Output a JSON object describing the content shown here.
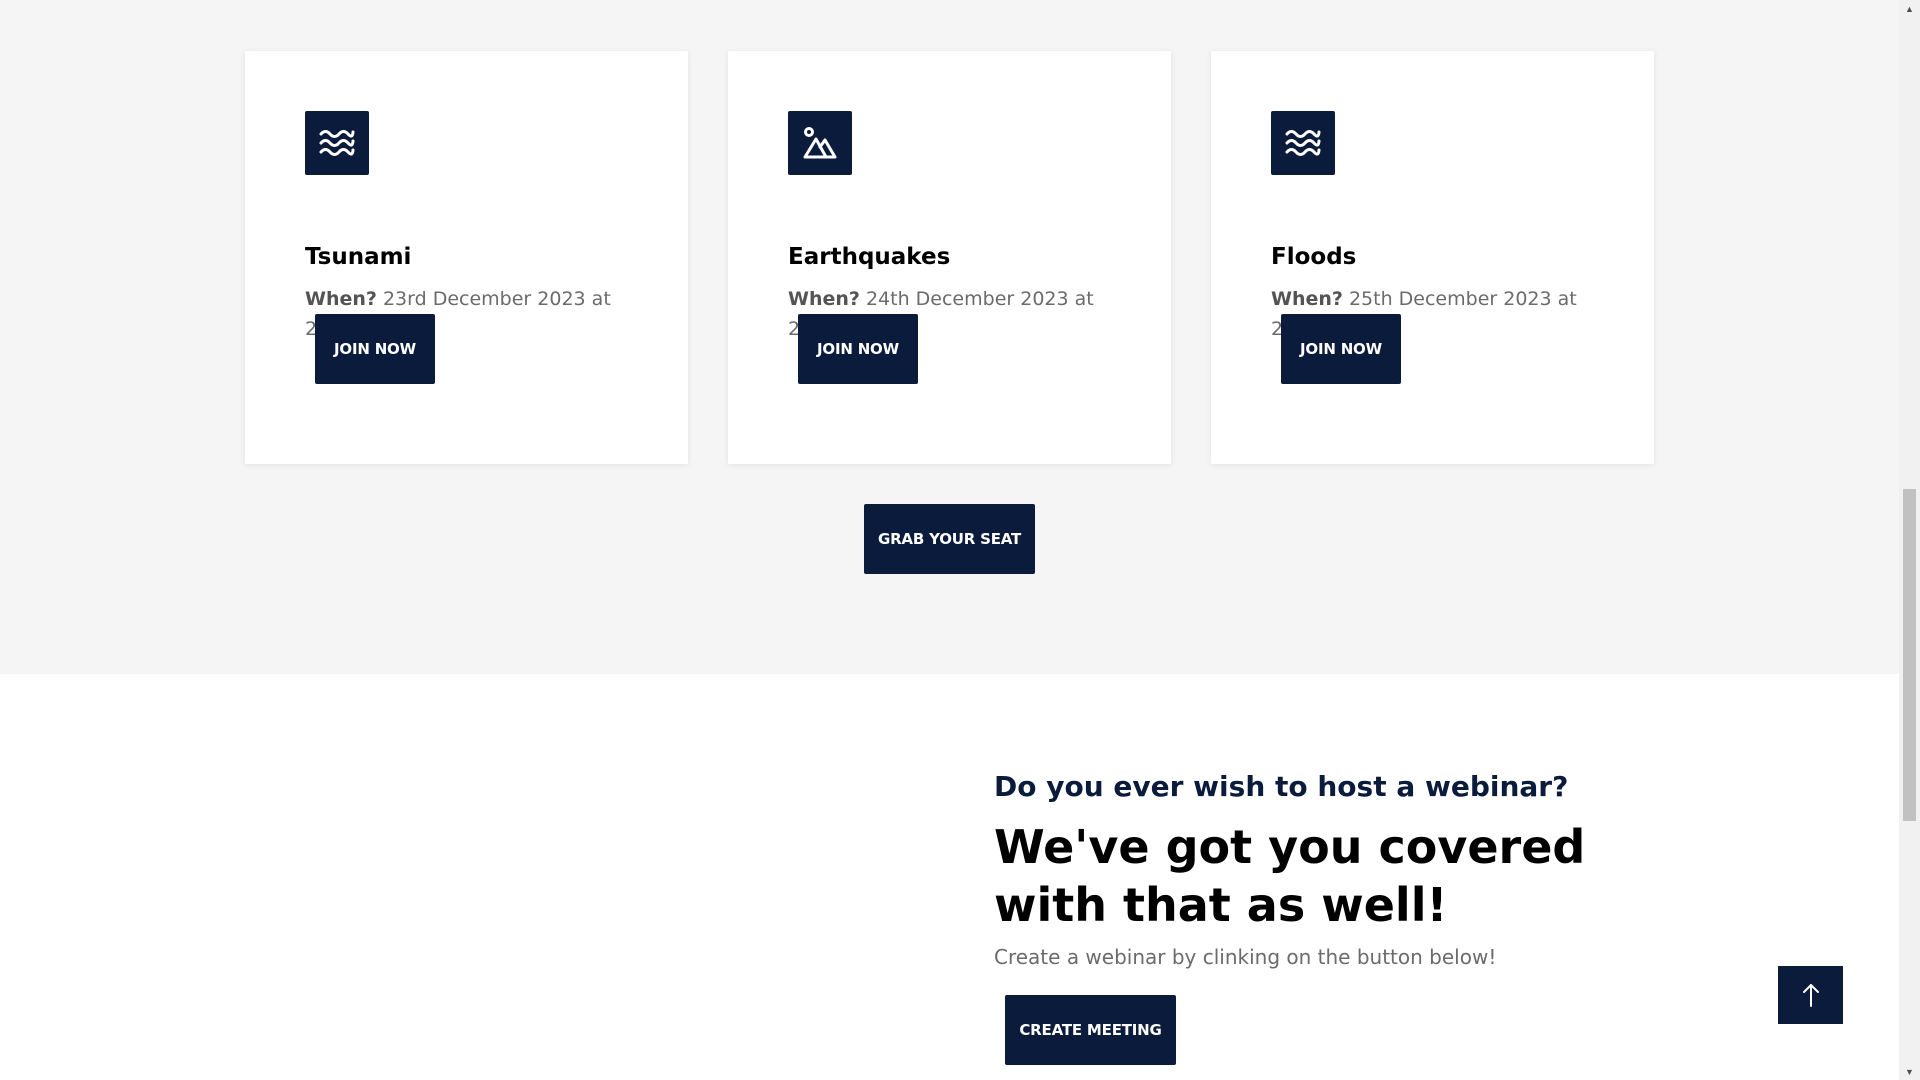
{
  "cards": [
    {
      "icon": "waves-icon",
      "title": "Tsunami",
      "when_label": "When?",
      "when_value": " 23rd December 2023 at 2:00PM",
      "button_label": "JOIN NOW"
    },
    {
      "icon": "mountain-icon",
      "title": "Earthquakes",
      "when_label": "When?",
      "when_value": " 24th December 2023 at 2:00PM",
      "button_label": "JOIN NOW"
    },
    {
      "icon": "waves-icon",
      "title": "Floods",
      "when_label": "When?",
      "when_value": " 25th December 2023 at 2:00PM",
      "button_label": "JOIN NOW"
    }
  ],
  "grab_button_label": "GRAB YOUR SEAT",
  "webinar": {
    "subheading": "Do you ever wish to host a webinar?",
    "heading": "We've got you covered with that as well!",
    "description": "Create a webinar by clinking on the button below!",
    "button_label": "CREATE MEETING"
  },
  "scroll_top_icon": "arrow-up-icon",
  "colors": {
    "primary": "#0b1b3b",
    "section_bg": "#f5f5f5",
    "muted_text": "#6b6b6b"
  }
}
